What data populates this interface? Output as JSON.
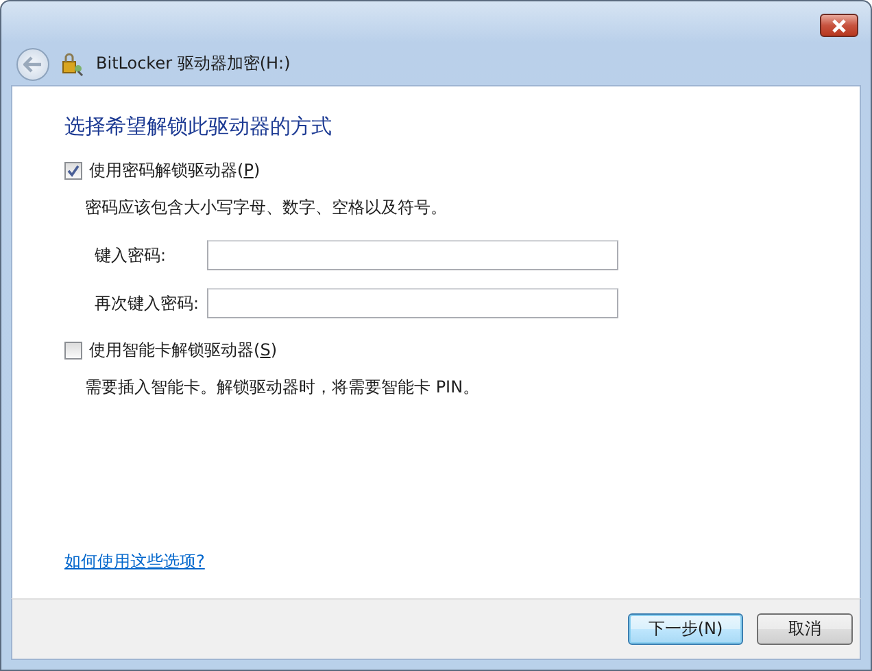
{
  "window": {
    "title": "BitLocker 驱动器加密(H:)"
  },
  "heading": "选择希望解锁此驱动器的方式",
  "options": [
    {
      "label_parts": [
        "使用密码解锁驱动器(",
        "P",
        ")"
      ],
      "checked": true,
      "description": "密码应该包含大小写字母、数字、空格以及符号。",
      "fields": [
        {
          "label": "键入密码:"
        },
        {
          "label": "再次键入密码:"
        }
      ]
    },
    {
      "label_parts": [
        "使用智能卡解锁驱动器(",
        "S",
        ")"
      ],
      "checked": false,
      "description": "需要插入智能卡。解锁驱动器时，将需要智能卡 PIN。"
    }
  ],
  "help_link": "如何使用这些选项?",
  "buttons": [
    {
      "label": "下一步(N)",
      "default": true
    },
    {
      "label": "取消",
      "default": false
    }
  ]
}
